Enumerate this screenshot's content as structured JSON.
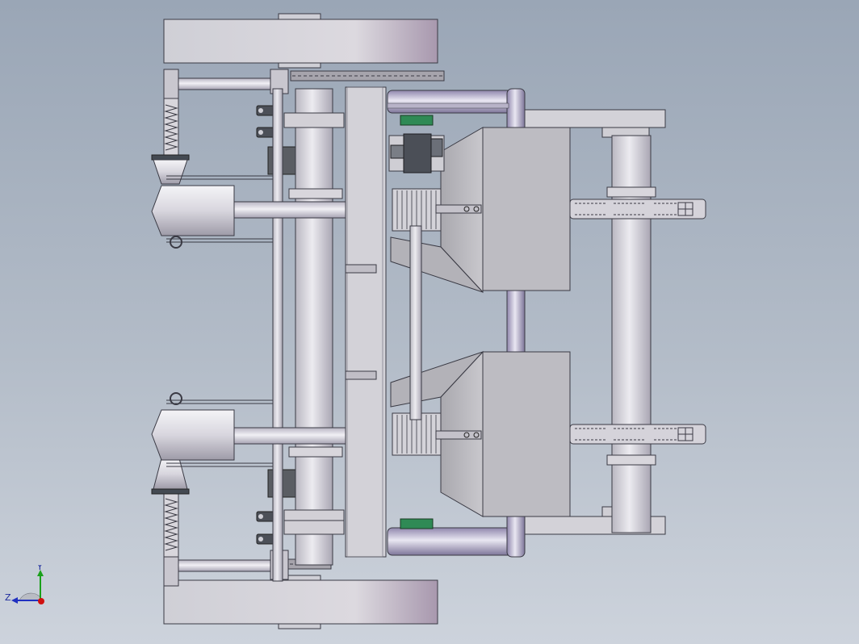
{
  "view": {
    "background_top": "#9aa6b6",
    "background_bottom": "#cdd3dc",
    "part_fill": "#d6d4da",
    "part_stroke": "#3a3a44",
    "accent_purple": "#9a8aa8",
    "accent_green": "#2f8a55",
    "dark_block": "#55585e"
  },
  "triad": {
    "axis_y": "Y",
    "axis_z": "Z",
    "color_y": "#1aa01a",
    "color_z": "#2030c0",
    "color_x": "#d01010"
  }
}
